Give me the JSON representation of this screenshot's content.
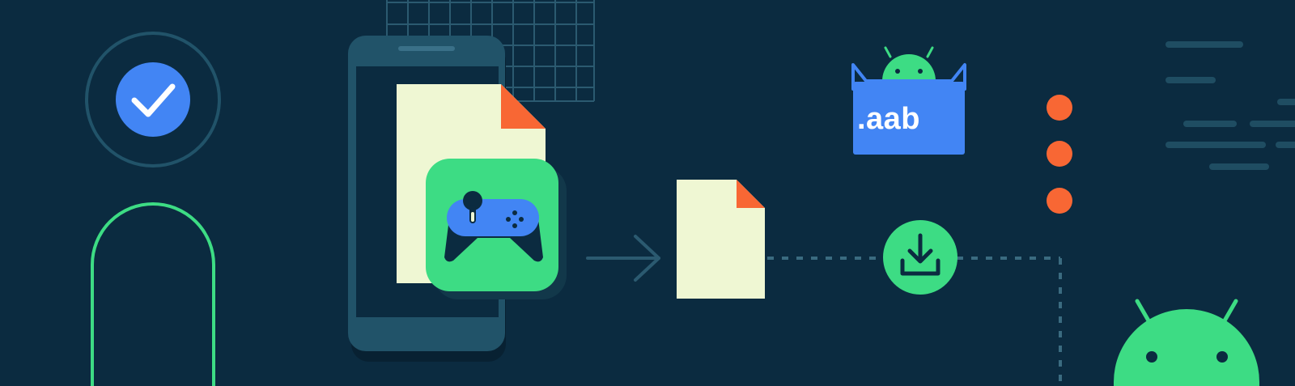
{
  "illustration": {
    "bundle_label": ".aab",
    "colors": {
      "background": "#0b2b40",
      "android_green": "#3ddc84",
      "google_blue": "#4285f4",
      "accent_orange": "#f86734",
      "paper": "#eff7d3",
      "phone_body": "#215369",
      "line_muted": "#1f4d62"
    },
    "icons": [
      "check-icon",
      "game-controller-icon",
      "download-icon",
      "android-icon",
      "arrow-right-icon",
      "document-icon"
    ]
  }
}
